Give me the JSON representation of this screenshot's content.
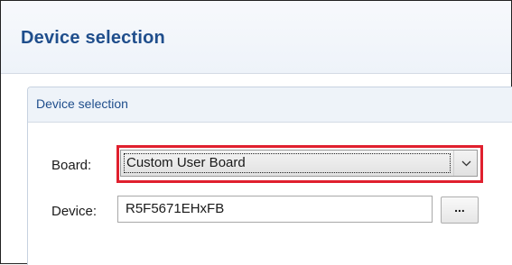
{
  "header": {
    "title": "Device selection"
  },
  "section": {
    "title": "Device selection"
  },
  "board": {
    "label": "Board:",
    "selected_value": "Custom User Board",
    "highlight_color": "#e0202e"
  },
  "device": {
    "label": "Device:",
    "value": "R5F5671EHxFB",
    "browse_label": "..."
  },
  "icons": {
    "dropdown": "chevron-down-icon"
  },
  "colors": {
    "title": "#1f4e8c",
    "section_bg": "#eef3f9"
  }
}
